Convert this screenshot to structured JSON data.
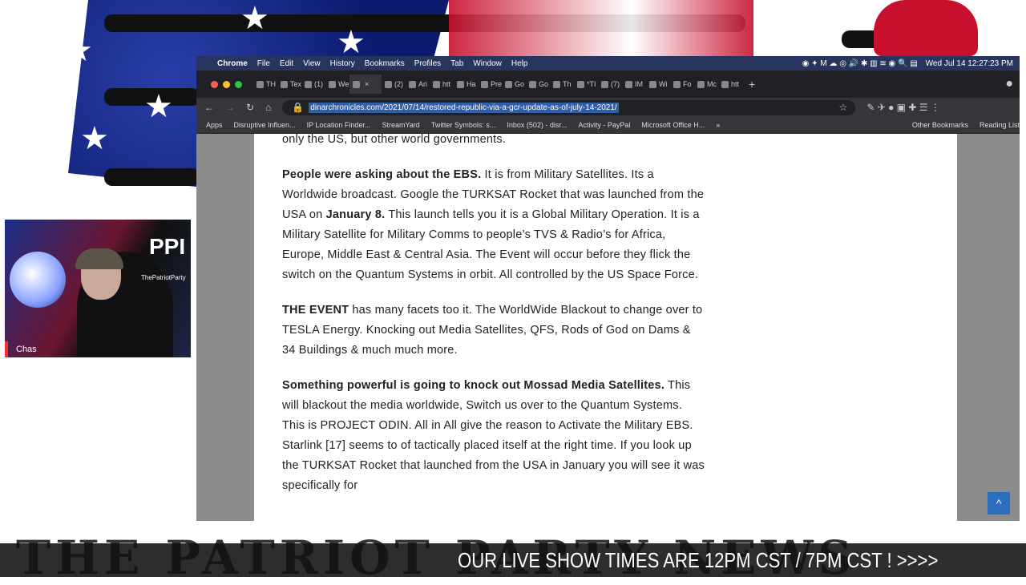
{
  "overlay": {
    "cam_name": "Chas",
    "cam_logo": "PPI",
    "cam_site": "ThePatriotParty",
    "brand": "THE PATRIOT PARTY NEWS",
    "ticker": "OUR LIVE SHOW TIMES ARE 12PM CST / 7PM CST ! >>>>"
  },
  "menubar": {
    "app": "Chrome",
    "items": [
      "File",
      "Edit",
      "View",
      "History",
      "Bookmarks",
      "Profiles",
      "Tab",
      "Window",
      "Help"
    ],
    "clock": "Wed Jul 14  12:27:23 PM"
  },
  "tabs": [
    "TH",
    "Tex",
    "(1)",
    "We",
    "",
    "(2)",
    "Ari",
    "htt",
    "Ha",
    "Pre",
    "Go",
    "Go",
    "Th",
    "*TI",
    "(7)",
    "IM",
    "Wi",
    "Fo",
    "Mc",
    "htt"
  ],
  "active_tab_index": 4,
  "address": {
    "url": "dinarchronicles.com/2021/07/14/restored-republic-via-a-gcr-update-as-of-july-14-2021/"
  },
  "bookmarks": [
    "Apps",
    "Disruptive Influen...",
    "IP Location Finder...",
    "StreamYard",
    "Twitter Symbols: s...",
    "Inbox (502) - disr...",
    "Activity - PayPal",
    "Microsoft Office H...",
    "»",
    "Other Bookmarks",
    "Reading List"
  ],
  "article": {
    "lead": "only the US, but other world governments.",
    "paragraphs": [
      [
        {
          "b": true,
          "t": "People were asking about the EBS."
        },
        {
          "b": false,
          "t": " It is from Military Satellites. Its a Worldwide broadcast. Google the TURKSAT Rocket that was launched from the USA on "
        },
        {
          "b": true,
          "t": "January 8."
        },
        {
          "b": false,
          "t": "  This launch tells you it is a Global Military Operation. It is a Military Satellite for Military Comms to people’s TVS & Radio’s for Africa, Europe, Middle East & Central Asia. The Event will occur before they flick the switch on the Quantum Systems in orbit. All controlled by the US Space Force."
        }
      ],
      [
        {
          "b": true,
          "t": "THE EVENT"
        },
        {
          "b": false,
          "t": " has many facets too it. The WorldWide Blackout to change over to TESLA Energy. Knocking out Media Satellites, QFS,  Rods of God on Dams & 34 Buildings & much much more."
        }
      ],
      [
        {
          "b": true,
          "t": "Something powerful is going to knock out Mossad Media Satellites."
        },
        {
          "b": false,
          "t": " This will blackout the media worldwide, Switch us over to the Quantum Systems. This is PROJECT ODIN. All in All give the reason to Activate the Military EBS. Starlink [17] seems to of tactically placed itself at the right time. If you look up the TURKSAT Rocket that launched from the USA in January you will see it was specifically for"
        }
      ]
    ]
  }
}
